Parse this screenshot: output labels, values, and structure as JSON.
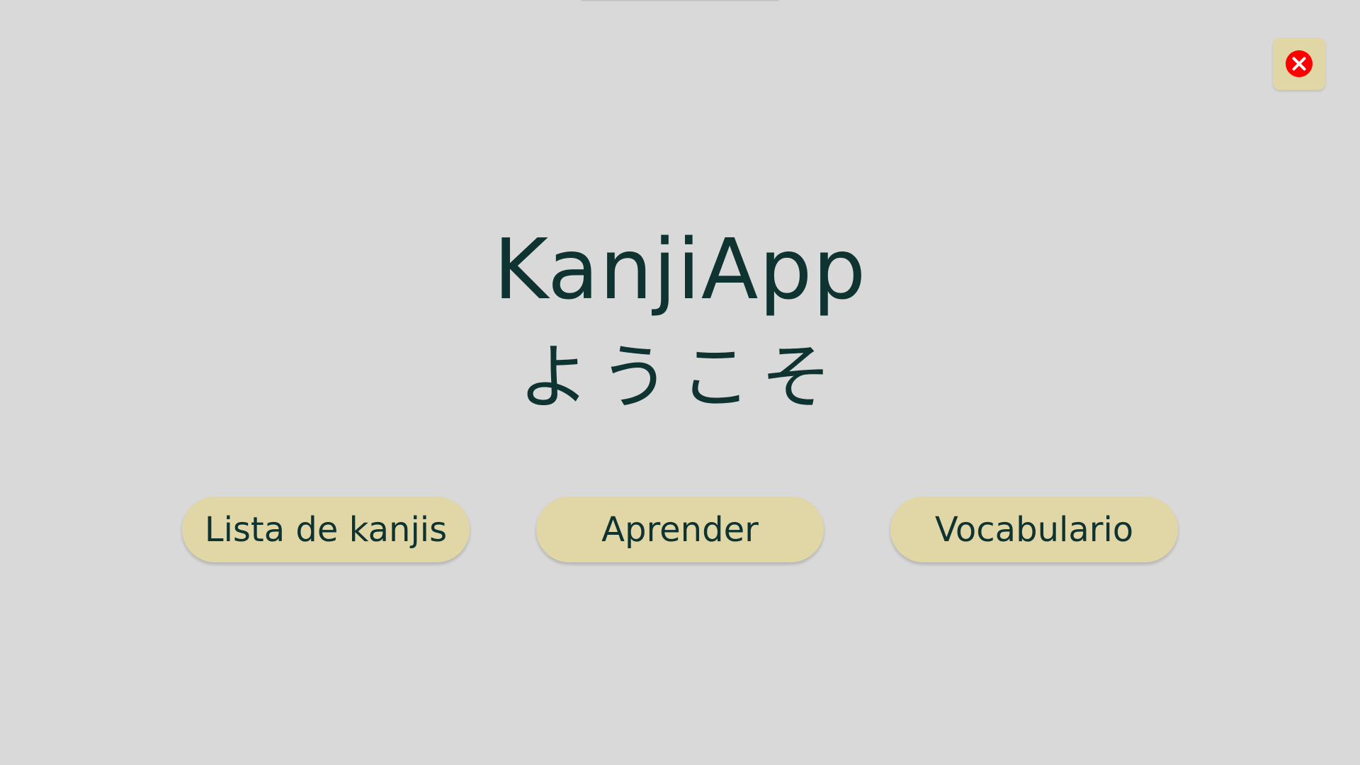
{
  "app": {
    "title": "KanjiApp",
    "subtitle": "ようこそ"
  },
  "menu": {
    "buttons": [
      {
        "label": "Lista de kanjis"
      },
      {
        "label": "Aprender"
      },
      {
        "label": "Vocabulario"
      }
    ]
  },
  "close_button": {
    "icon": "close-icon"
  },
  "colors": {
    "background": "#d9d9d9",
    "button_fill": "#e0d6a6",
    "text": "#0e3331",
    "close_icon": "#ff0000"
  }
}
